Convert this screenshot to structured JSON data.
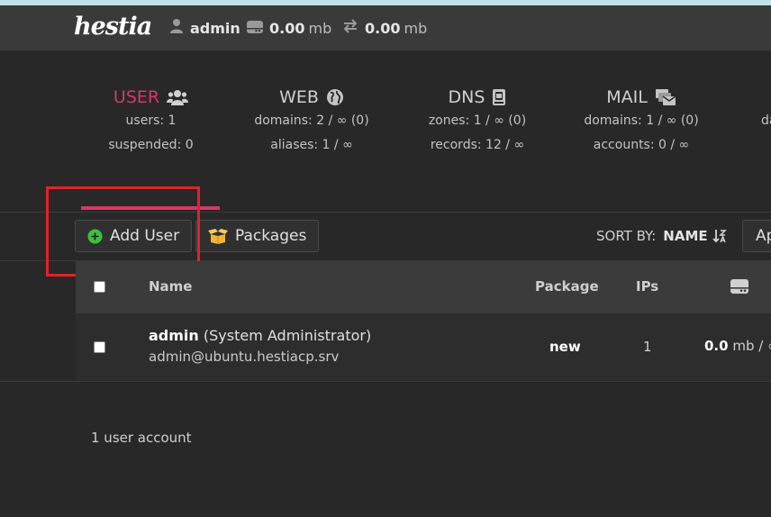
{
  "topbar": {
    "logo": "hestia",
    "user": "admin",
    "disk_value": "0.00",
    "disk_unit": "mb",
    "bandwidth_value": "0.00",
    "bandwidth_unit": "mb"
  },
  "stats": [
    {
      "title": "USER",
      "icon": "users-icon",
      "lines": [
        "users: 1",
        "suspended: 0"
      ]
    },
    {
      "title": "WEB",
      "icon": "globe-icon",
      "lines": [
        "domains: 2 / ∞ (0)",
        "aliases: 1 / ∞"
      ]
    },
    {
      "title": "DNS",
      "icon": "book-icon",
      "lines": [
        "zones: 1 / ∞ (0)",
        "records: 12 / ∞"
      ]
    },
    {
      "title": "MAIL",
      "icon": "mail-bulk-icon",
      "lines": [
        "domains: 1 / ∞ (0)",
        "accounts: 0 / ∞"
      ]
    },
    {
      "title": "",
      "icon": "",
      "lines": [
        "da"
      ]
    }
  ],
  "toolbar": {
    "add_user_label": "Add User",
    "packages_label": "Packages",
    "sort_label": "SORT BY:",
    "sort_value": "NAME",
    "apply_label": "Ap"
  },
  "table": {
    "headers": {
      "name": "Name",
      "package": "Package",
      "ips": "IPs",
      "disk_icon": "hdd-icon"
    },
    "rows": [
      {
        "username": "admin",
        "role": "(System Administrator)",
        "email": "admin@ubuntu.hestiacp.srv",
        "package": "new",
        "ips": "1",
        "disk_value": "0.0",
        "disk_rest": "mb / ∞"
      }
    ]
  },
  "footer": {
    "count": "1 user account"
  },
  "colors": {
    "accent": "#d63865",
    "highlight_box": "#e2222a",
    "add_icon": "#3fbf3f",
    "packages_icon": "#f2b530"
  }
}
